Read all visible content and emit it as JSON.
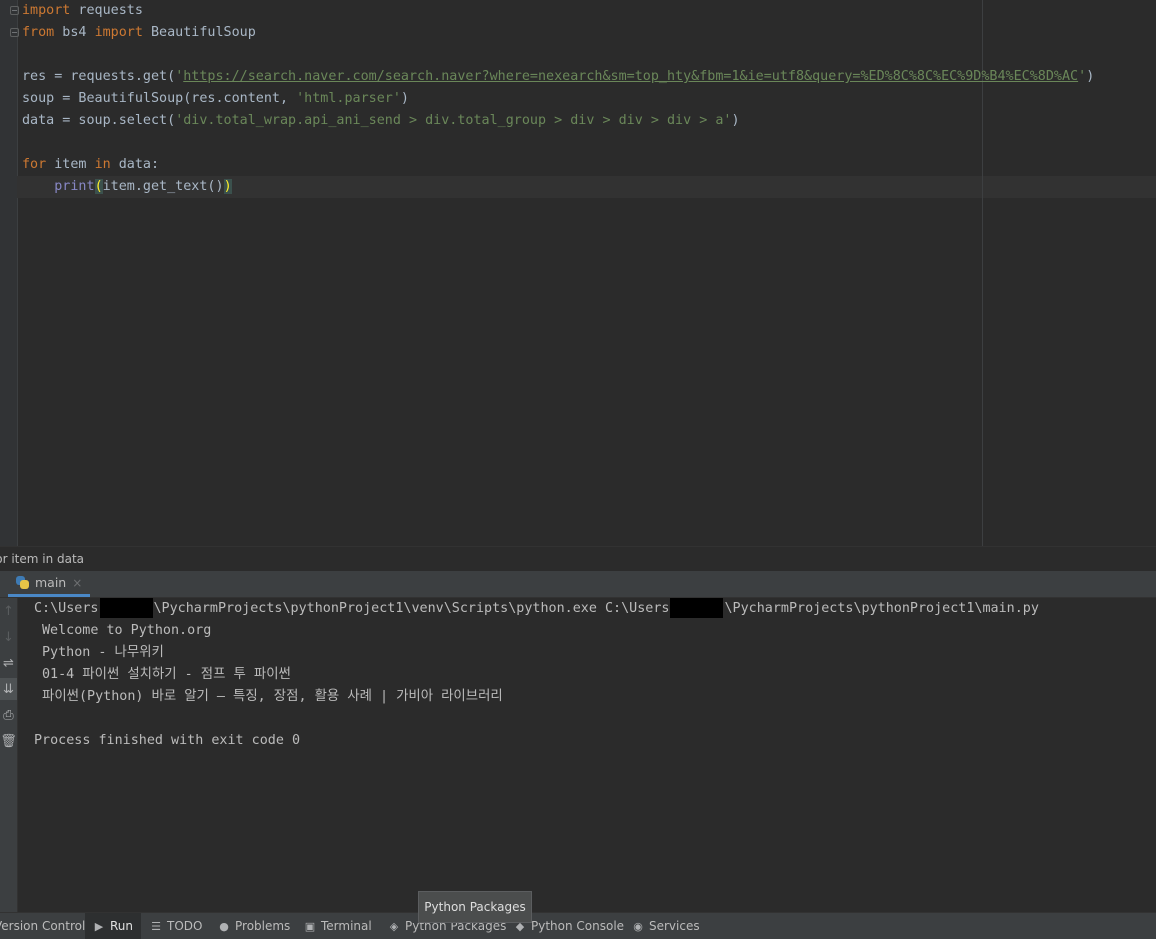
{
  "editor": {
    "lines": [
      {
        "parts": [
          {
            "t": "import",
            "c": "kw"
          },
          {
            "t": " requests"
          }
        ]
      },
      {
        "parts": [
          {
            "t": "from",
            "c": "kw"
          },
          {
            "t": " bs4 "
          },
          {
            "t": "import",
            "c": "kw"
          },
          {
            "t": " BeautifulSoup"
          }
        ]
      },
      {
        "parts": []
      },
      {
        "parts": [
          {
            "t": "res = requests.get("
          },
          {
            "t": "'",
            "c": "str"
          },
          {
            "t": "https://search.naver.com/search.naver?where=nexearch&sm=top_hty&fbm=1&ie=utf8&query=%ED%8C%8C%EC%9D%B4%EC%8D%AC",
            "c": "url"
          },
          {
            "t": "'",
            "c": "str"
          },
          {
            "t": ")"
          }
        ]
      },
      {
        "parts": [
          {
            "t": "soup = BeautifulSoup(res.content, "
          },
          {
            "t": "'html.parser'",
            "c": "str"
          },
          {
            "t": ")"
          }
        ]
      },
      {
        "parts": [
          {
            "t": "data = soup.select("
          },
          {
            "t": "'div.total_wrap.api_ani_send > div.total_group > div > div > div > a'",
            "c": "str"
          },
          {
            "t": ")"
          }
        ]
      },
      {
        "parts": []
      },
      {
        "parts": [
          {
            "t": "for",
            "c": "kw"
          },
          {
            "t": " item "
          },
          {
            "t": "in",
            "c": "kw"
          },
          {
            "t": " data:"
          }
        ]
      },
      {
        "parts": [
          {
            "t": "    "
          },
          {
            "t": "print",
            "c": "builtin"
          },
          {
            "t": "(",
            "c": "brace"
          },
          {
            "t": "item.get_text()"
          },
          {
            "t": ")",
            "c": "brace"
          }
        ]
      }
    ]
  },
  "breadcrumb": {
    "text": "for item in data"
  },
  "run_window": {
    "tab_label": "main",
    "tab_close": "×",
    "toolbar": [
      {
        "name": "rerun-up-icon",
        "glyph": "↑",
        "disabled": true
      },
      {
        "name": "rerun-down-icon",
        "glyph": "↓",
        "disabled": true
      },
      {
        "name": "soft-wrap-icon",
        "glyph": "⇌",
        "disabled": false
      },
      {
        "name": "scroll-to-end-icon",
        "glyph": "⇊",
        "disabled": false,
        "active": true
      },
      {
        "name": "print-icon",
        "glyph": "⎙",
        "disabled": false
      },
      {
        "name": "trash-icon",
        "glyph": "🗑",
        "disabled": false
      }
    ],
    "command": {
      "part1": "C:\\Users",
      "part2": "\\PycharmProjects\\pythonProject1\\venv\\Scripts\\python.exe C:\\Users",
      "part3": "\\PycharmProjects\\pythonProject1\\main.py"
    },
    "output": [
      "Welcome to Python.org",
      "Python - 나무위키",
      "01-4 파이썬 설치하기 - 점프 투 파이썬",
      "파이썬(Python) 바로 알기 – 특징, 장점, 활용 사례 | 가비아 라이브러리"
    ],
    "exit_line": "Process finished with exit code 0"
  },
  "tooltip": {
    "text": "Python Packages"
  },
  "bottom_bar": {
    "items": [
      {
        "label": "Version Control",
        "icon": ""
      },
      {
        "label": "Run",
        "icon": "▶",
        "active": true
      },
      {
        "label": "TODO",
        "icon": "☰"
      },
      {
        "label": "Problems",
        "icon": "●"
      },
      {
        "label": "Terminal",
        "icon": "▣"
      },
      {
        "label": "Python Packages",
        "icon": "◈"
      },
      {
        "label": "Python Console",
        "icon": "◆"
      },
      {
        "label": "Services",
        "icon": "◉"
      }
    ]
  }
}
